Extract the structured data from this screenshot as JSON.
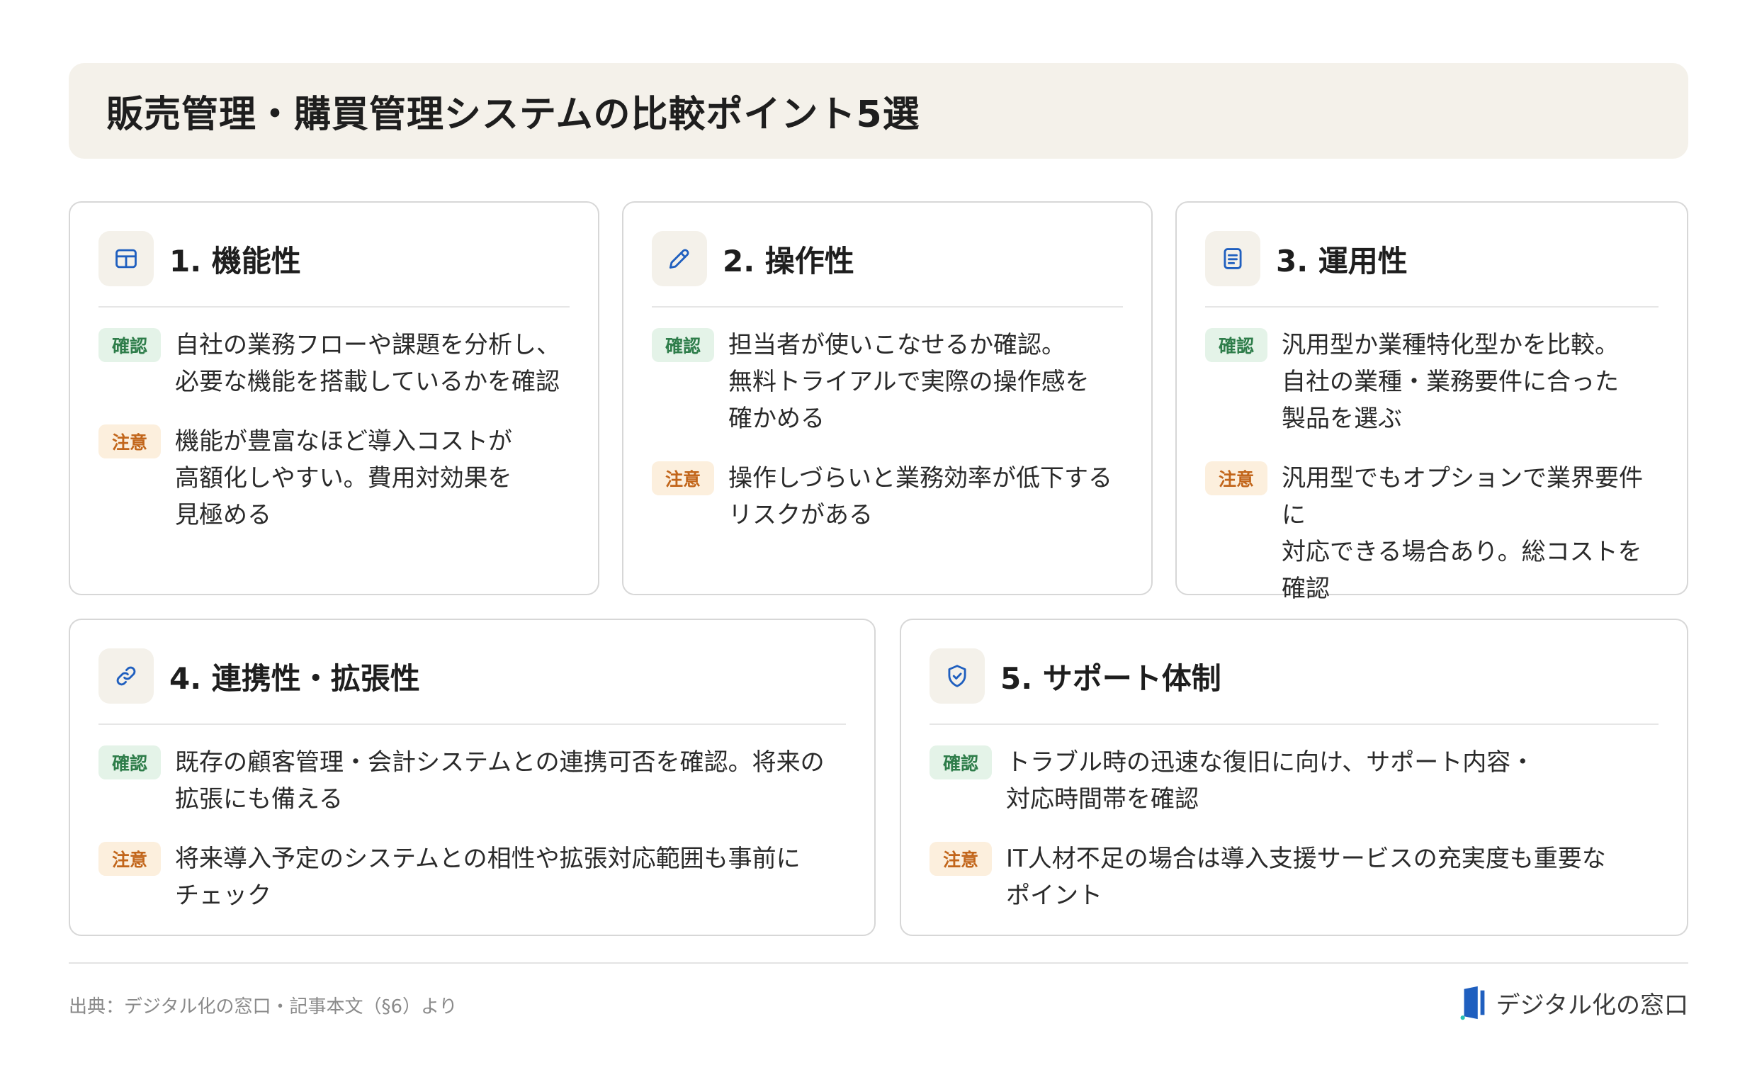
{
  "title": "販売管理・購買管理システムの比較ポイント5選",
  "badges": {
    "confirm": "確認",
    "caution": "注意"
  },
  "cards": [
    {
      "title": "1. 機能性",
      "icon": "table-icon",
      "confirm": "自社の業務フローや課題を分析し、\n必要な機能を搭載しているかを確認",
      "caution": "機能が豊富なほど導入コストが\n高額化しやすい。費用対効果を\n見極める"
    },
    {
      "title": "2. 操作性",
      "icon": "pencil-icon",
      "confirm": "担当者が使いこなせるか確認。\n無料トライアルで実際の操作感を\n確かめる",
      "caution": "操作しづらいと業務効率が低下する\nリスクがある"
    },
    {
      "title": "3. 運用性",
      "icon": "document-icon",
      "confirm": "汎用型か業種特化型かを比較。\n自社の業種・業務要件に合った\n製品を選ぶ",
      "caution": "汎用型でもオプションで業界要件に\n対応できる場合あり。総コストを\n確認"
    },
    {
      "title": "4. 連携性・拡張性",
      "icon": "link-icon",
      "confirm": "既存の顧客管理・会計システムとの連携可否を確認。将来の\n拡張にも備える",
      "caution": "将来導入予定のシステムとの相性や拡張対応範囲も事前に\nチェック"
    },
    {
      "title": "5. サポート体制",
      "icon": "shield-check-icon",
      "confirm": "トラブル時の迅速な復旧に向け、サポート内容・\n対応時間帯を確認",
      "caution": "IT人材不足の場合は導入支援サービスの充実度も重要な\nポイント"
    }
  ],
  "footer": {
    "source": "出典：デジタル化の窓口・記事本文（§6）より",
    "brand": "デジタル化の窓口"
  },
  "colors": {
    "icon_blue": "#1f5fbf",
    "confirm_bg": "#e4f3e8",
    "confirm_text": "#2e7d4a",
    "caution_bg": "#fcefdd",
    "caution_text": "#c2661b",
    "title_bg": "#f4f1ea"
  }
}
